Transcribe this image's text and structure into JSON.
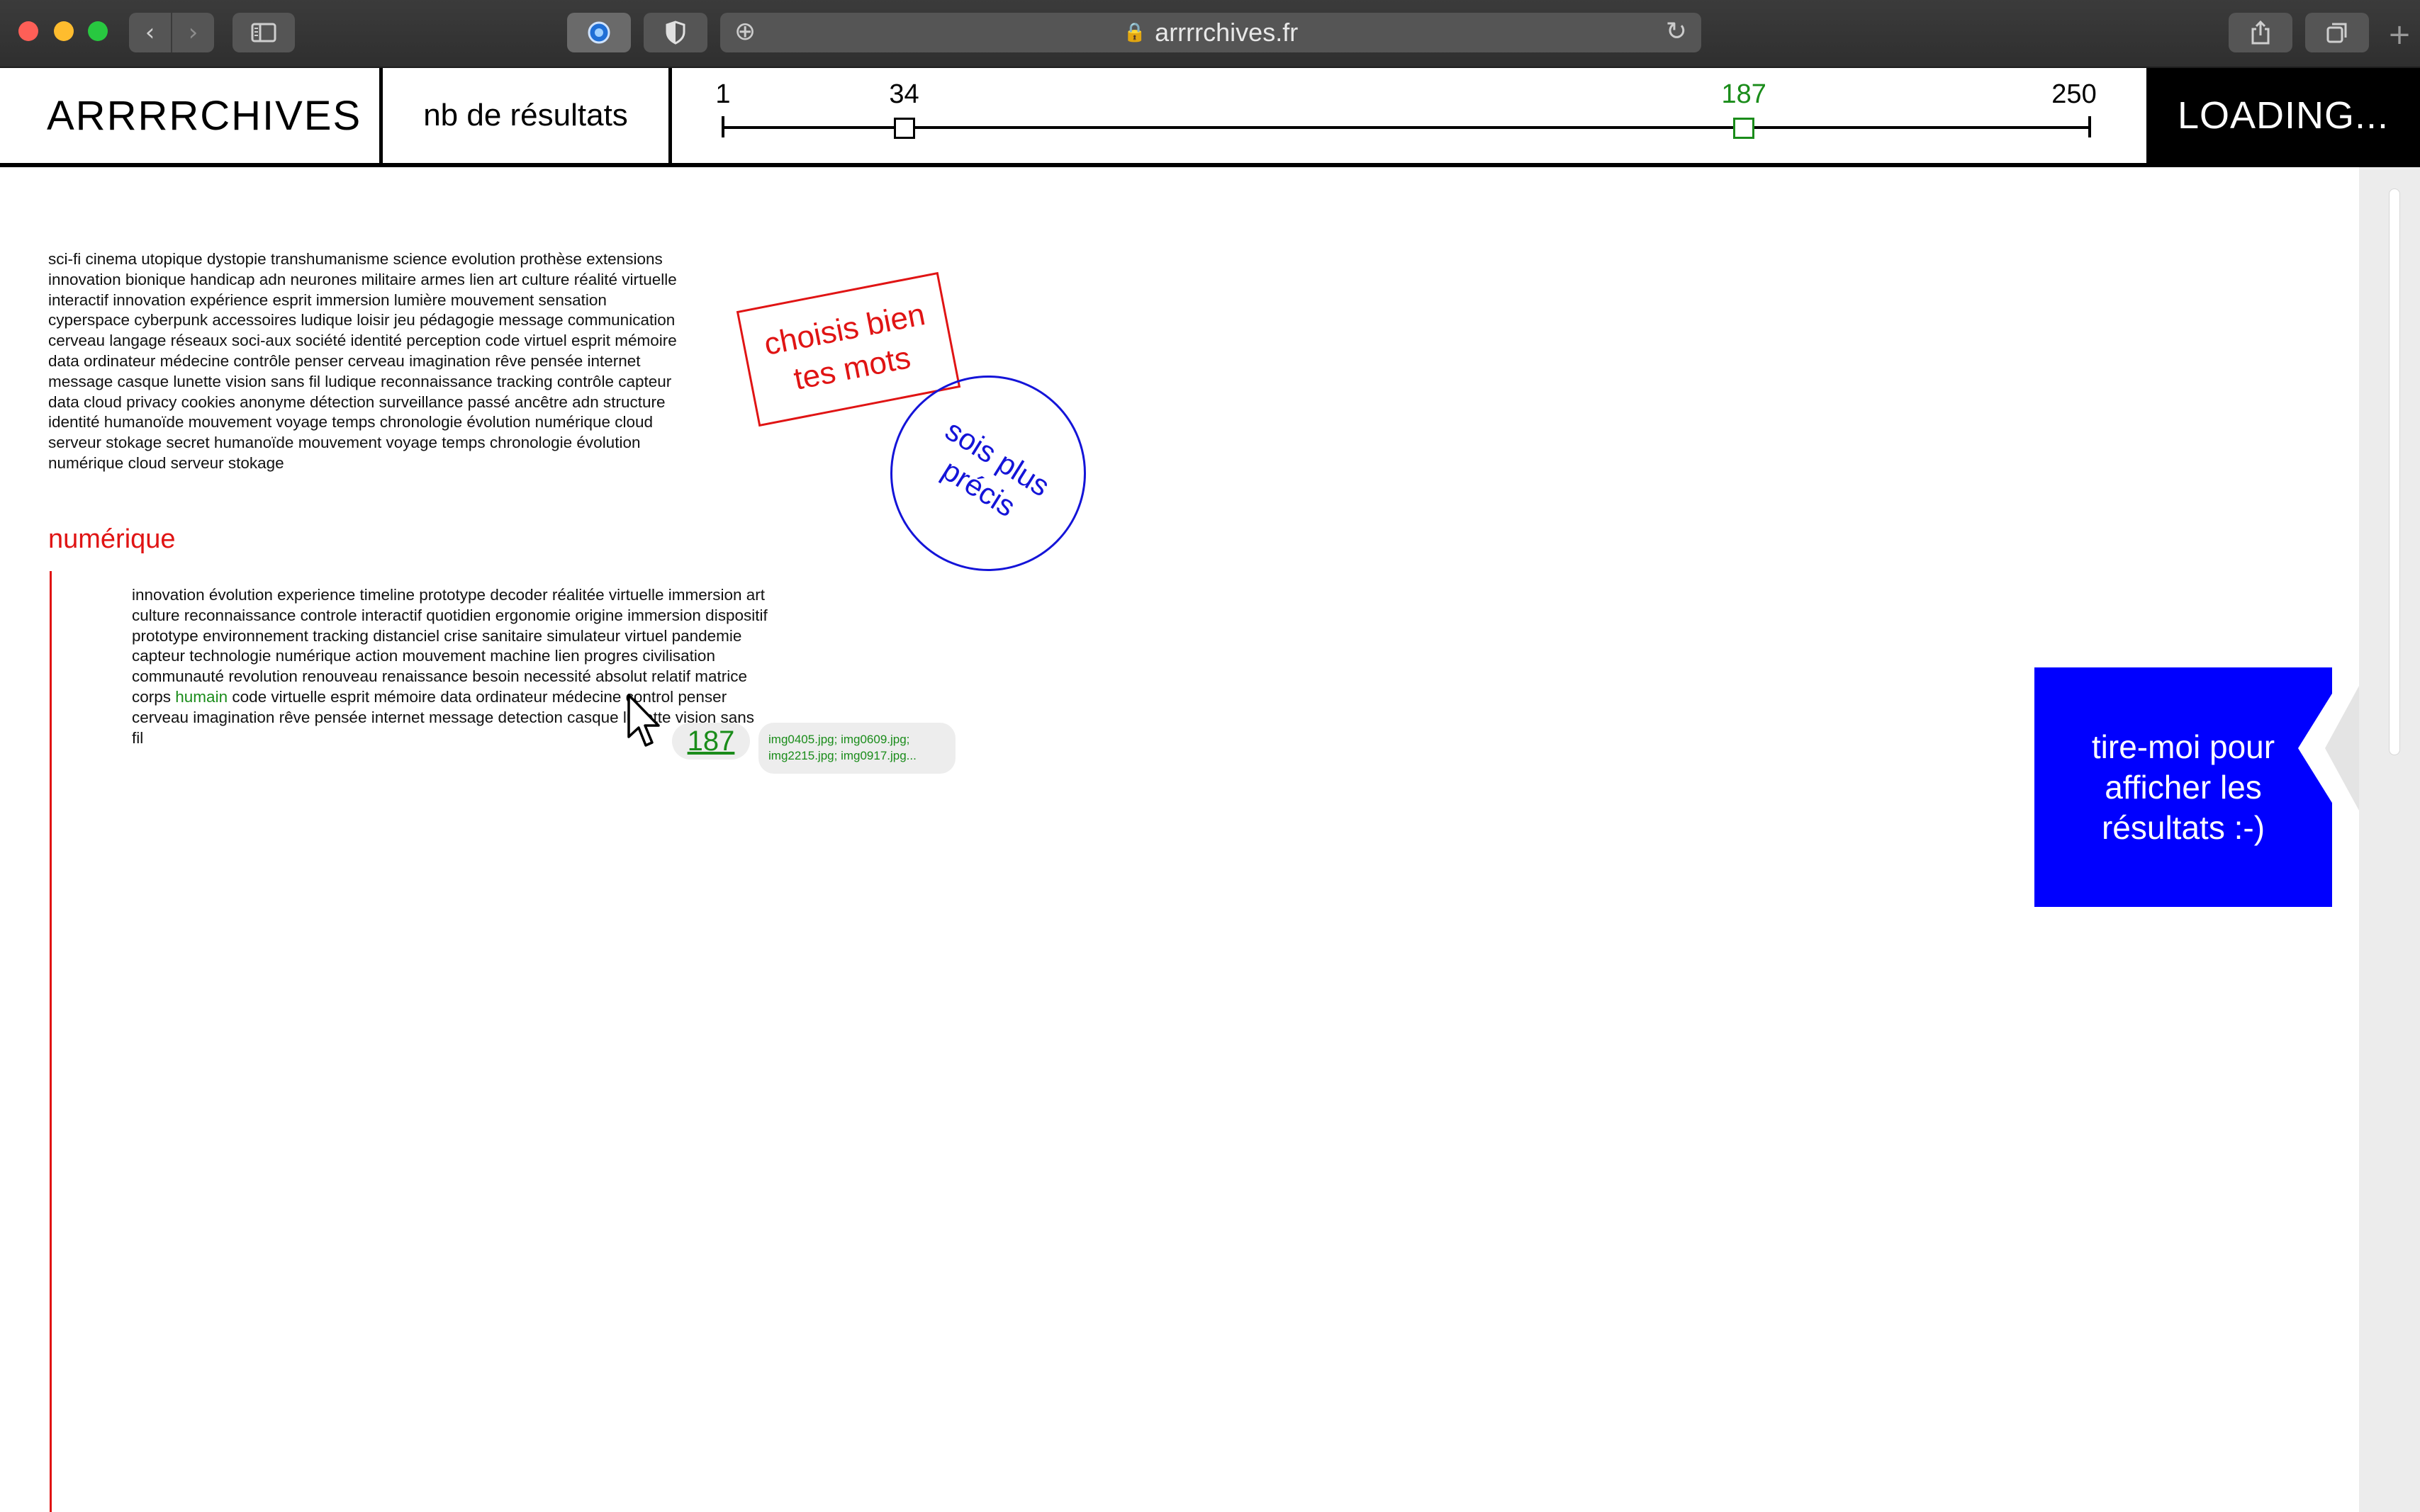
{
  "browser": {
    "url": "arrrrchives.fr"
  },
  "header": {
    "logo": "ARRRRCHIVES",
    "results_label": "nb de résultats",
    "slider": {
      "min": 1,
      "max": 250,
      "low": 34,
      "high": 187,
      "min_label": "1",
      "max_label": "250",
      "low_label": "34",
      "high_label": "187",
      "high_color": "#1a8c1a"
    },
    "status": "LOADING..."
  },
  "content": {
    "tag_cloud_1": "sci-fi cinema utopique dystopie transhumanisme science evolution prothèse extensions innovation bionique handicap adn neurones militaire armes lien art culture réalité virtuelle interactif innovation expérience esprit immersion lumière mouvement sensation cyperspace cyberpunk accessoires ludique loisir jeu pédagogie message communication cerveau langage réseaux soci-aux société identité perception code virtuel esprit mémoire data ordinateur médecine contrôle penser cerveau imagination rêve pensée internet message casque lunette vision sans fil ludique reconnaissance tracking contrôle capteur data cloud privacy cookies anonyme détection surveillance passé ancêtre adn structure identité humanoïde mouvement voyage temps chronologie évolution numérique cloud serveur stokage secret humanoïde mouvement voyage temps chronologie évolution numérique cloud serveur stokage",
    "section_title": "numérique",
    "tag_cloud_2_before": "innovation évolution experience timeline prototype decoder réalitée virtuelle immersion art culture reconnaissance controle interactif quotidien ergonomie origine immersion dispositif prototype environnement tracking distanciel crise sanitaire simulateur virtuel pandemie capteur technologie numérique  action mouvement machine lien progres civilisation communauté revolution renouveau renaissance besoin necessité absolut relatif matrice corps ",
    "tag_cloud_2_highlight": "humain",
    "tag_cloud_2_after": " code virtuelle esprit mémoire data ordinateur médecine control penser cerveau imagination rêve pensée internet message detection casque lunette vision sans fil",
    "highlight_color": "#1a8c1a",
    "stamp_red": "choisis bien tes mots",
    "stamp_blue": "sois plus précis",
    "result_count": "187",
    "result_files": "img0405.jpg; img0609.jpg; img2215.jpg; img0917.jpg...",
    "pull_tab": "tire-moi pour afficher les résultats :-)"
  },
  "colors": {
    "red": "#e01414",
    "blue": "#0000ff",
    "green": "#1a8c1a"
  },
  "icons": [
    "back-icon",
    "forward-icon",
    "sidebar-icon",
    "extension-icon",
    "shield-icon",
    "new-tab-plus-icon",
    "lock-icon",
    "reload-icon",
    "share-icon",
    "tabs-icon",
    "plus-icon",
    "mouse-cursor-icon"
  ]
}
